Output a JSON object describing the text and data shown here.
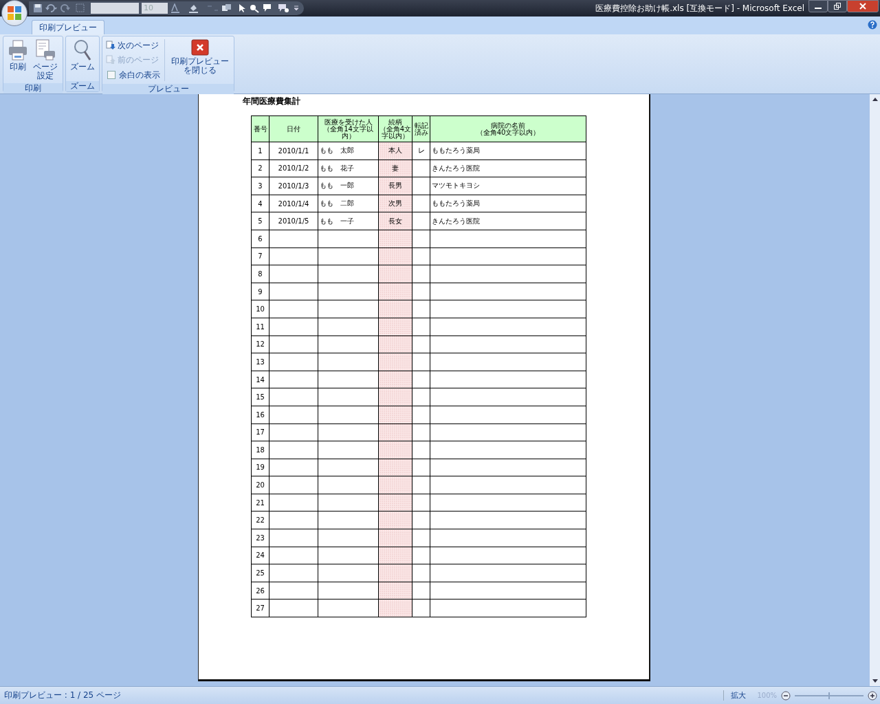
{
  "window": {
    "title": "医療費控除お助け帳.xls  [互換モード] - Microsoft Excel"
  },
  "quick_access": {
    "font_size": "10"
  },
  "tabs": [
    {
      "label": "印刷プレビュー",
      "selected": true
    }
  ],
  "ribbon": {
    "groups": [
      {
        "label": "印刷",
        "buttons": [
          {
            "label": "印刷",
            "kind": "printer"
          },
          {
            "label": "ページ設定",
            "kind": "page-setup"
          }
        ]
      },
      {
        "label": "ズーム",
        "buttons": [
          {
            "label": "ズーム",
            "kind": "zoom"
          }
        ]
      },
      {
        "label": "プレビュー",
        "small": [
          {
            "label": "次のページ",
            "kind": "next",
            "disabled": false
          },
          {
            "label": "前のページ",
            "kind": "prev",
            "disabled": true
          },
          {
            "label": "余白の表示",
            "kind": "checkbox",
            "checked": false
          }
        ],
        "buttons": [
          {
            "label": "印刷プレビューを閉じる",
            "kind": "close"
          }
        ]
      }
    ]
  },
  "sheet": {
    "title": "年間医療費集計",
    "columns": [
      {
        "title": "番号"
      },
      {
        "title": "日付"
      },
      {
        "title": "医療を受けた人",
        "note": "（全角14文字以内）"
      },
      {
        "title": "続柄",
        "note": "（全角4文字以内）"
      },
      {
        "title": "転記済み"
      },
      {
        "title": "病院の名前",
        "note": "（全角40文字以内）"
      }
    ],
    "rows": [
      {
        "number": "1",
        "date": "2010/1/1",
        "person": "もも　太郎",
        "relation": "本人",
        "transcribed": "レ",
        "hospital": "ももたろう薬局"
      },
      {
        "number": "2",
        "date": "2010/1/2",
        "person": "もも　花子",
        "relation": "妻",
        "hospital": "きんたろう医院"
      },
      {
        "number": "3",
        "date": "2010/1/3",
        "person": "もも　一郎",
        "relation": "長男",
        "hospital": "マツモトキヨシ"
      },
      {
        "number": "4",
        "date": "2010/1/4",
        "person": "もも　二郎",
        "relation": "次男",
        "hospital": "ももたろう薬局"
      },
      {
        "number": "5",
        "date": "2010/1/5",
        "person": "もも　一子",
        "relation": "長女",
        "hospital": "きんたろう医院"
      },
      {
        "number": "6"
      },
      {
        "number": "7"
      },
      {
        "number": "8"
      },
      {
        "number": "9"
      },
      {
        "number": "10"
      },
      {
        "number": "11"
      },
      {
        "number": "12"
      },
      {
        "number": "13"
      },
      {
        "number": "14"
      },
      {
        "number": "15"
      },
      {
        "number": "16"
      },
      {
        "number": "17"
      },
      {
        "number": "18"
      },
      {
        "number": "19"
      },
      {
        "number": "20"
      },
      {
        "number": "21"
      },
      {
        "number": "22"
      },
      {
        "number": "23"
      },
      {
        "number": "24"
      },
      {
        "number": "25"
      },
      {
        "number": "26"
      },
      {
        "number": "27"
      }
    ]
  },
  "status_bar": {
    "text": "印刷プレビュー : 1 / 25 ページ",
    "zoom_in_label": "拡大",
    "zoom_percent": "100%",
    "zoom_slider": {
      "level": 0.5
    }
  }
}
